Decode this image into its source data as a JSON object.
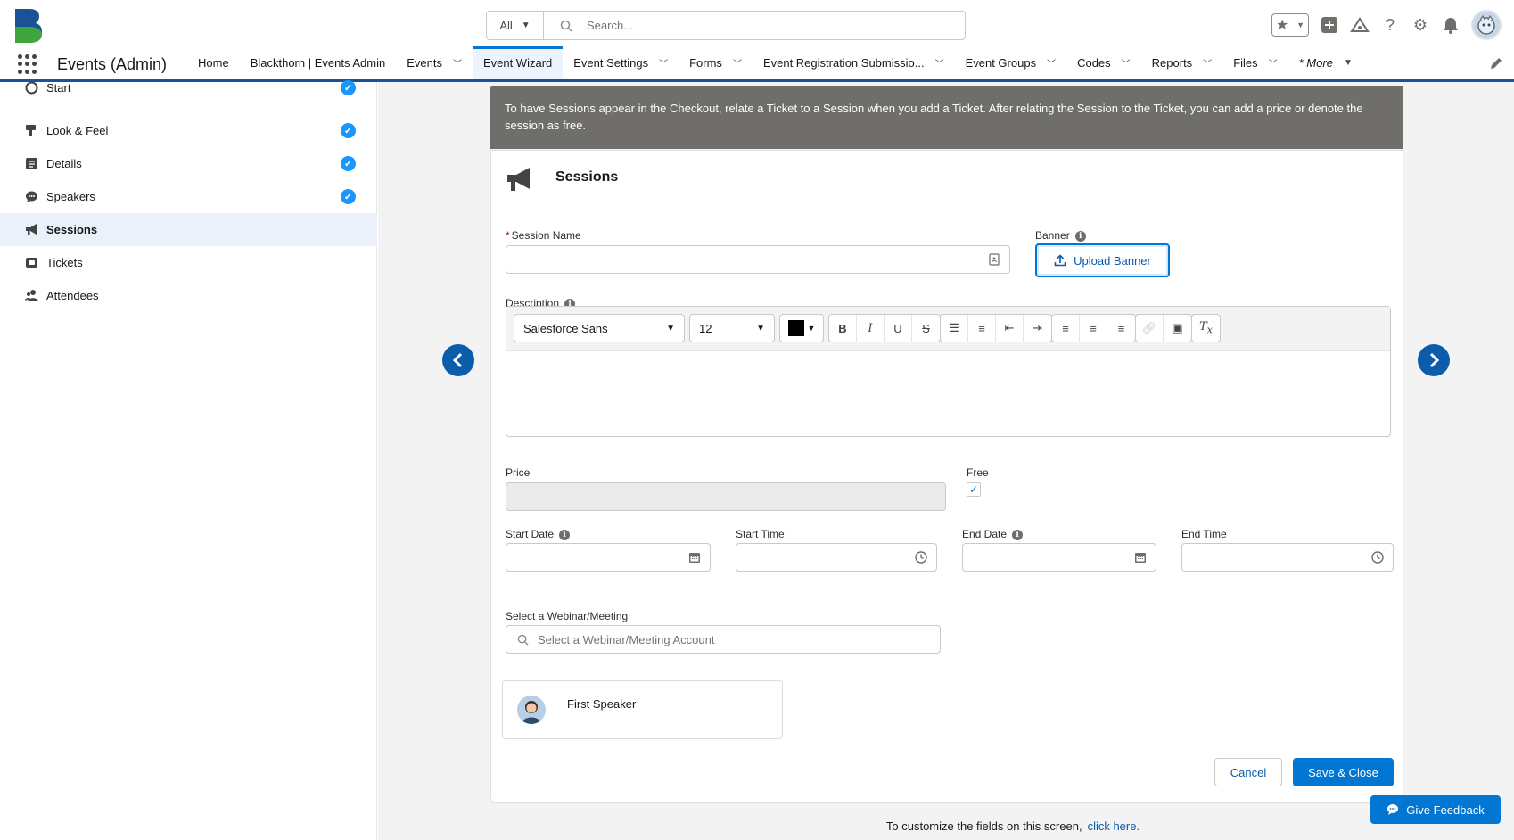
{
  "header": {
    "search_scope": "All",
    "search_placeholder": "Search..."
  },
  "nav": {
    "app_name": "Events (Admin)",
    "tabs": [
      {
        "label": "Home",
        "has_menu": false
      },
      {
        "label": "Blackthorn | Events Admin",
        "has_menu": false
      },
      {
        "label": "Events",
        "has_menu": true
      },
      {
        "label": "Event Wizard",
        "has_menu": false,
        "active": true
      },
      {
        "label": "Event Settings",
        "has_menu": true
      },
      {
        "label": "Forms",
        "has_menu": true
      },
      {
        "label": "Event Registration Submissio...",
        "has_menu": true
      },
      {
        "label": "Event Groups",
        "has_menu": true
      },
      {
        "label": "Codes",
        "has_menu": true
      },
      {
        "label": "Reports",
        "has_menu": true
      },
      {
        "label": "Files",
        "has_menu": true
      }
    ],
    "more_label": "* More"
  },
  "sidebar": {
    "steps": [
      {
        "label": "Start",
        "icon": "start-icon",
        "complete": true
      },
      {
        "label": "Look & Feel",
        "icon": "paint-icon",
        "complete": true
      },
      {
        "label": "Details",
        "icon": "details-icon",
        "complete": true
      },
      {
        "label": "Speakers",
        "icon": "chat-icon",
        "complete": true
      },
      {
        "label": "Sessions",
        "icon": "megaphone-icon",
        "complete": false,
        "active": true
      },
      {
        "label": "Tickets",
        "icon": "ticket-icon",
        "complete": false
      },
      {
        "label": "Attendees",
        "icon": "people-icon",
        "complete": false
      }
    ]
  },
  "main": {
    "info_banner": "To have Sessions appear in the Checkout, relate a Ticket to a Session when you add a Ticket. After relating the Session to the Ticket, you can add a price or denote the session as free.",
    "card_title": "Sessions",
    "session_name_label": "Session Name",
    "session_name_value": "",
    "banner_label": "Banner",
    "upload_banner_label": "Upload Banner",
    "description_label": "Description",
    "rte": {
      "font_family": "Salesforce Sans",
      "font_size": "12",
      "text_color": "#000000"
    },
    "price_label": "Price",
    "free_label": "Free",
    "free_checked": true,
    "start_date_label": "Start Date",
    "start_time_label": "Start Time",
    "end_date_label": "End Date",
    "end_time_label": "End Time",
    "webinar_label": "Select a Webinar/Meeting",
    "webinar_placeholder": "Select a Webinar/Meeting Account",
    "speaker_name": "First Speaker",
    "cancel_label": "Cancel",
    "save_close_label": "Save & Close",
    "footer_text": "To customize the fields on this screen,",
    "footer_link": "click here."
  },
  "feedback_label": "Give Feedback",
  "colors": {
    "brand": "#0176d3",
    "nav_underline": "#1b5297",
    "banner_bg": "#706e6b",
    "check": "#1b96ff"
  }
}
